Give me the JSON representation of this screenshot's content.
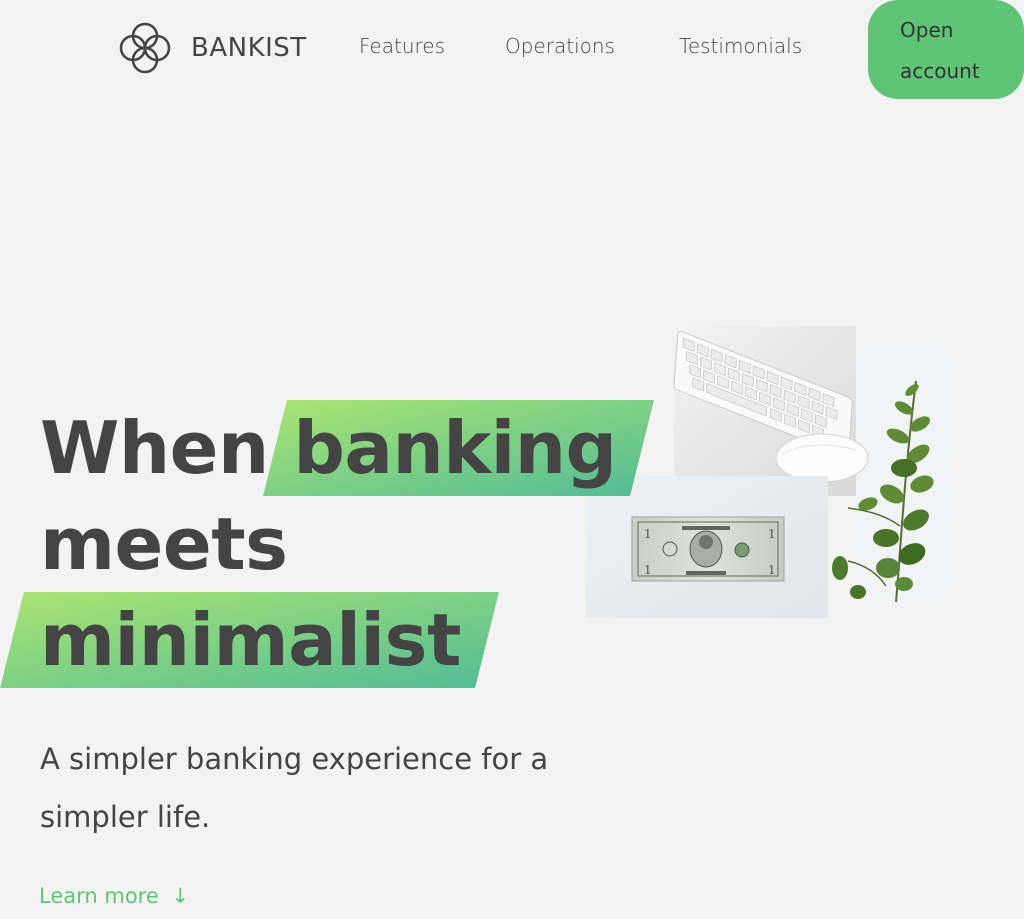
{
  "nav": {
    "brand": "BANKIST",
    "links": [
      {
        "label": "Features"
      },
      {
        "label": "Operations"
      },
      {
        "label": "Testimonials"
      }
    ],
    "cta": {
      "line1": "Open",
      "line2": "account"
    }
  },
  "hero": {
    "title": {
      "word1": "When",
      "word2": "banking",
      "word3": "meets",
      "word4": "minimalist"
    },
    "subtitle": "A simpler banking experience for a simpler life.",
    "learn_more": "Learn more",
    "learn_more_arrow": "↓",
    "image_icon": "keyboard-dollar-plant-illustration"
  },
  "colors": {
    "background": "#f3f3f3",
    "accent": "#5ec576",
    "highlight_start": "#9be15d",
    "highlight_end": "#39b385",
    "text": "#444444"
  }
}
